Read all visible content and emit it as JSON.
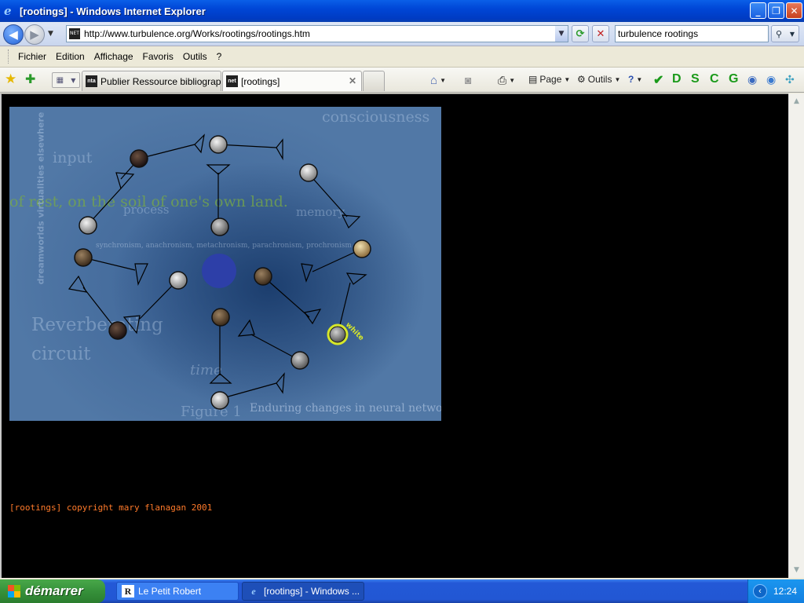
{
  "window": {
    "title": "[rootings] - Windows Internet Explorer",
    "minimize": "_",
    "maximize": "❐",
    "close": "✕"
  },
  "address_bar": {
    "url": "http://www.turbulence.org/Works/rootings/rootings.htm",
    "search_value": "turbulence rootings"
  },
  "menu": {
    "items": [
      "Fichier",
      "Edition",
      "Affichage",
      "Favoris",
      "Outils",
      "?"
    ]
  },
  "tabs": [
    {
      "label": "Publier Ressource bibliograph...",
      "icon": "nta"
    },
    {
      "label": "[rootings]",
      "icon": "net"
    }
  ],
  "commands": {
    "page": "Page",
    "tools": "Outils",
    "letters": [
      "D",
      "S",
      "C",
      "G"
    ]
  },
  "artwork": {
    "texts": {
      "consciousness": "consciousness",
      "input": "input",
      "soil": "of rest, on the soil of one's own land.",
      "process": "process",
      "memory": "memory",
      "reverb": "Reverberating",
      "circuit": "circuit",
      "time": "time",
      "enduring": "Enduring changes in neural networks must",
      "figure": "Figure 1",
      "vertical": "dreamworlds  virtualities  elsewhere",
      "chronism": "synchronism, anachronism, metachronism, parachronism, prochronism"
    },
    "node_label": "white",
    "colors": {
      "center": "#2d3fa8",
      "highlight": "#d6e62a"
    }
  },
  "footer": {
    "copyright": "[rootings] copyright mary flanagan 2001"
  },
  "taskbar": {
    "start": "démarrer",
    "items": [
      {
        "label": "Le Petit Robert",
        "icon": "R"
      },
      {
        "label": "[rootings] - Windows ...",
        "icon": "e"
      }
    ],
    "clock": "12:24"
  }
}
